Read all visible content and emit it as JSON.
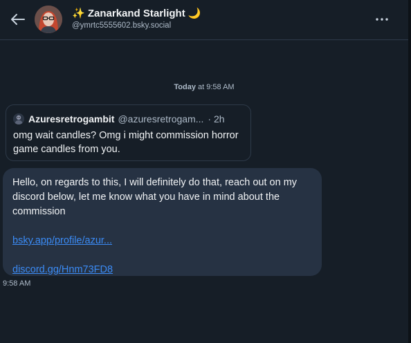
{
  "header": {
    "name": "✨ Zanarkand Starlight 🌙",
    "handle": "@ymrtc5555602.bsky.social",
    "back_icon": "arrow-left-icon",
    "more_icon": "more-horizontal-icon"
  },
  "thread": {
    "date_day": "Today",
    "date_time": " at 9:58 AM"
  },
  "quote": {
    "author": "Azuresretrogambit",
    "handle": "@azuresretrogam...",
    "time": "· 2h",
    "text": "omg wait candles? Omg i might commission horror game candles from you."
  },
  "message": {
    "text": "Hello, on regards to this, I will definitely do that,  reach out on my discord below, let me know what you have in mind about the commission",
    "link1": "bsky.app/profile/azur...",
    "link2": "discord.gg/Hnm73FD8",
    "time": "9:58 AM"
  },
  "colors": {
    "background": "#161e27",
    "bubble": "#263243",
    "link": "#3b8bf5",
    "muted_text": "#aebbc9"
  }
}
